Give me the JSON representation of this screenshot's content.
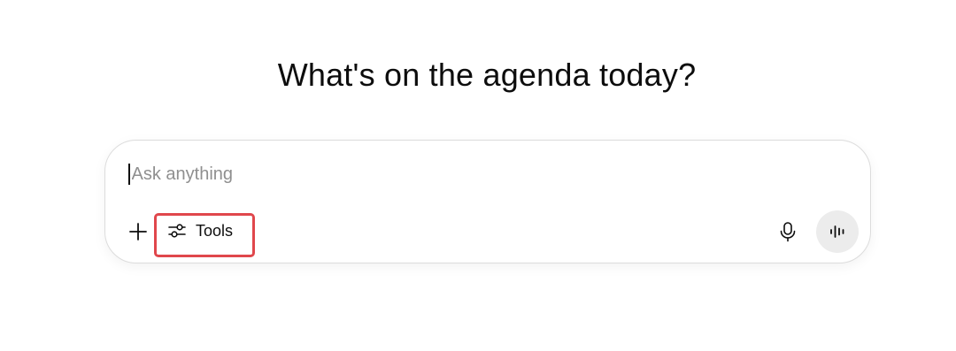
{
  "heading": "What's on the agenda today?",
  "composer": {
    "placeholder": "Ask anything",
    "value": ""
  },
  "toolbar": {
    "add_icon": "plus-icon",
    "tools_icon": "sliders-icon",
    "tools_label": "Tools",
    "mic_icon": "microphone-icon",
    "voice_icon": "voice-waveform-icon"
  },
  "colors": {
    "text": "#0d0d0d",
    "placeholder": "#8f8f8f",
    "highlight": "#e0474c",
    "voice_button_bg": "#ececec",
    "border": "#dcdcdc"
  }
}
